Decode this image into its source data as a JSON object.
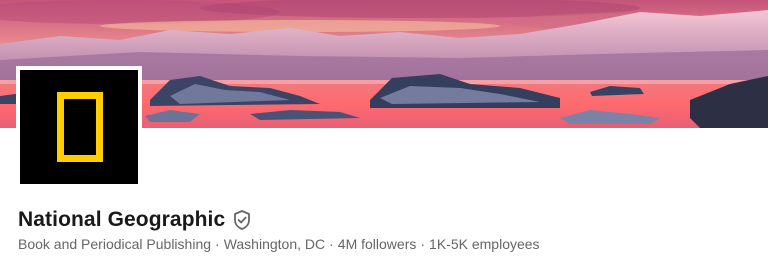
{
  "company": {
    "name": "National Geographic",
    "verified": true,
    "industry": "Book and Periodical Publishing",
    "location": "Washington, DC",
    "followers": "4M followers",
    "employees": "1K-5K employees",
    "separator": "·"
  },
  "cover": {
    "icon": "glacier-lagoon-sunset-image"
  },
  "logo": {
    "icon": "yellow-rectangle-logo",
    "colors": {
      "background": "#000000",
      "frame": "#ffce00"
    }
  },
  "colors": {
    "name_text": "#191919",
    "meta_text": "#666666",
    "verified_icon": "#666666"
  }
}
